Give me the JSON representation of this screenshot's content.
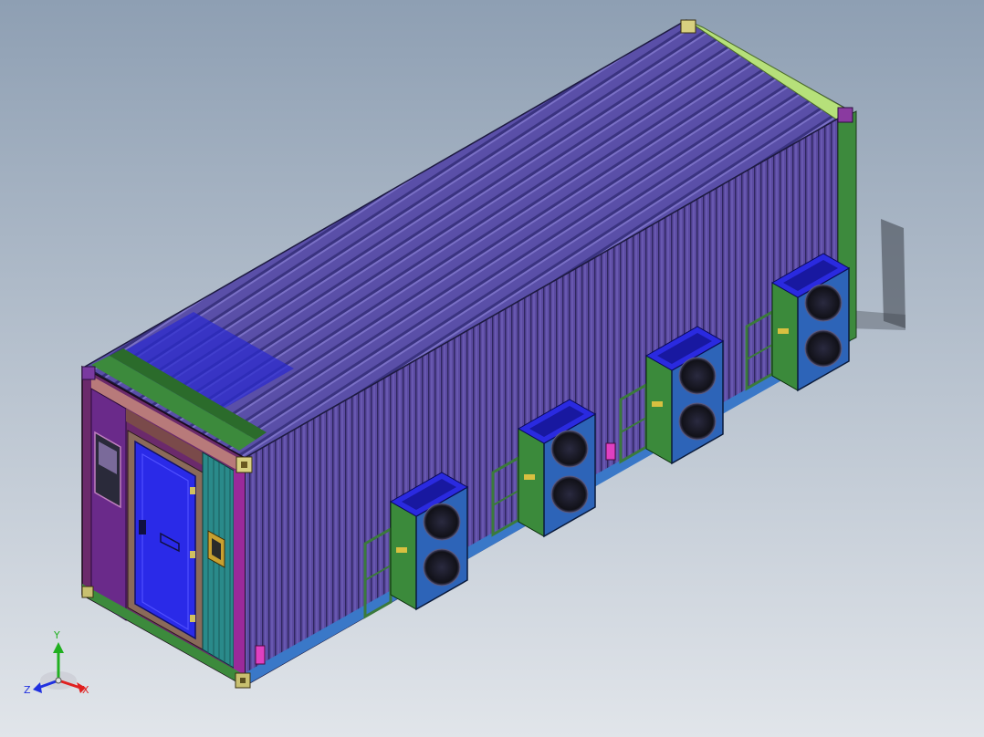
{
  "viewport": {
    "background_top": "#8e9fb3",
    "background_bottom": "#dfe3e8"
  },
  "triad": {
    "x_label": "X",
    "y_label": "Y",
    "z_label": "Z",
    "x_color": "#e02020",
    "y_color": "#20b020",
    "z_color": "#2030e0"
  },
  "model": {
    "roof_color": "#5a4fa8",
    "side_color": "#5b4aa0",
    "door_color": "#2a2ae8",
    "unit_color": "#2d64b8",
    "fan_color": "#1a1a2a",
    "rail_color": "#3b7a3b",
    "corner_color": "#c8c070",
    "outdoor_units": 4
  }
}
